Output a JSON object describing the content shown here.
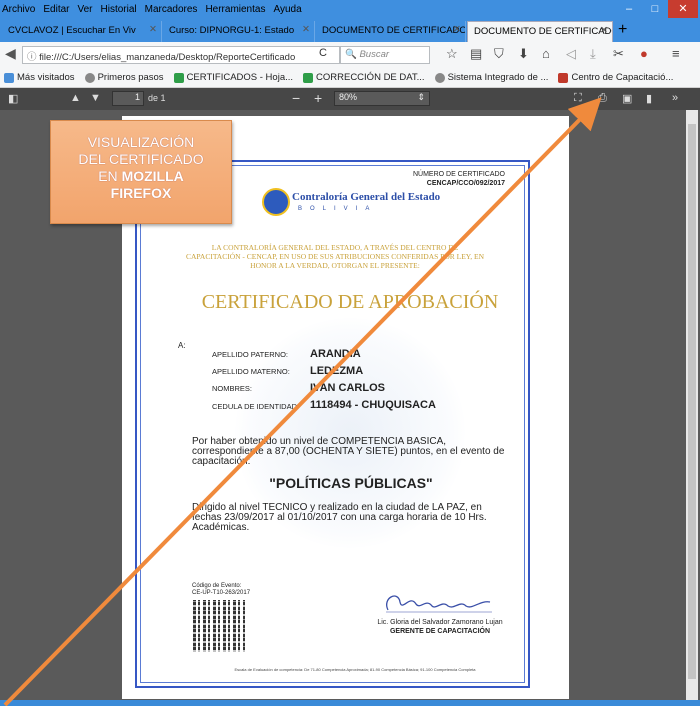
{
  "menubar": {
    "items": [
      "Archivo",
      "Editar",
      "Ver",
      "Historial",
      "Marcadores",
      "Herramientas",
      "Ayuda"
    ]
  },
  "window_controls": {
    "minimize": "–",
    "maximize": "□",
    "close": "✕"
  },
  "tabs": [
    {
      "label": "CVCLAVOZ | Escuchar En Viv",
      "active": false
    },
    {
      "label": "Curso: DIPNORGU-1: Estado",
      "active": false
    },
    {
      "label": "DOCUMENTO DE CERTIFICADO",
      "active": false
    },
    {
      "label": "DOCUMENTO DE CERTIFICADO",
      "active": true
    }
  ],
  "new_tab": "+",
  "navbar": {
    "url": "file:///C:/Users/elias_manzaneda/Desktop/ReporteCertificado",
    "search_placeholder": "Buscar"
  },
  "bookmarks": [
    {
      "label": "Más visitados",
      "color": "#4a8fd8"
    },
    {
      "label": "Primeros pasos",
      "color": "#888888"
    },
    {
      "label": "CERTIFICADOS - Hoja...",
      "color": "#2f9e49"
    },
    {
      "label": "CORRECCIÓN DE DAT...",
      "color": "#2f9e49"
    },
    {
      "label": "Sistema Integrado de ...",
      "color": "#888888"
    },
    {
      "label": "Centro de Capacitació...",
      "color": "#c0392b"
    }
  ],
  "pdf_toolbar": {
    "page_current": "1",
    "page_total": "de 1",
    "zoom": "80%",
    "minus": "−",
    "plus": "+"
  },
  "certificate": {
    "number_label": "NÚMERO DE CERTIFICADO",
    "number_value": "CENCAP/CCO/092/2017",
    "org_name": "Contraloría General del Estado",
    "org_country": "BOLIVIA",
    "intro": "LA CONTRALORÍA GENERAL DEL ESTADO, A TRAVÉS DEL CENTRO DE CAPACITACIÓN - CENCAP, EN USO DE SUS ATRIBUCIONES CONFERIDAS POR LEY, EN HONOR A LA VERDAD, OTORGAN EL PRESENTE:",
    "title": "CERTIFICADO DE APROBACIÓN",
    "to_label": "A:",
    "fields": [
      {
        "label": "APELLIDO PATERNO:",
        "value": "ARANDIA"
      },
      {
        "label": "APELLIDO MATERNO:",
        "value": "LEDEZMA"
      },
      {
        "label": "NOMBRES:",
        "value": "IVAN CARLOS"
      },
      {
        "label": "CEDULA DE IDENTIDAD:",
        "value": "1118494 - CHUQUISACA"
      }
    ],
    "competence_text": "Por haber obtenido un nivel de COMPETENCIA BASICA, correspondiente a 87,00 (OCHENTA Y SIETE) puntos, en el evento de capacitación:",
    "course": "\"POLÍTICAS PÚBLICAS\"",
    "details_text": "Dirigido al nivel TECNICO y realizado en la ciudad de LA PAZ, en fechas 23/09/2017 al 01/10/2017 con una carga horaria de 10 Hrs. Académicas.",
    "event_code_label": "Código de Evento:",
    "event_code": "CE-UP-T10-263/2017",
    "signer_name": "Lic. Gloria del Salvador Zamorano Lujan",
    "signer_title": "GERENTE DE CAPACITACIÓN",
    "footer_note": "Escala de Evaluación de competencia: De 71-80 Competencia Aproximada; 81-90 Competencia Básica; 91-100 Competencia Completa"
  },
  "callout": {
    "line1": "VISUALIZACIÓN",
    "line2": "DEL CERTIFICADO",
    "line3_prefix": "EN ",
    "line3_bold": "MOZILLA",
    "line4_bold": "FIREFOX"
  },
  "colors": {
    "accent_arrow": "#f08a3c",
    "callout_bg": "#f4ad79",
    "cert_gold": "#c9a23b",
    "cert_blue": "#3657c4",
    "pdf_toolbar": "#474747"
  }
}
